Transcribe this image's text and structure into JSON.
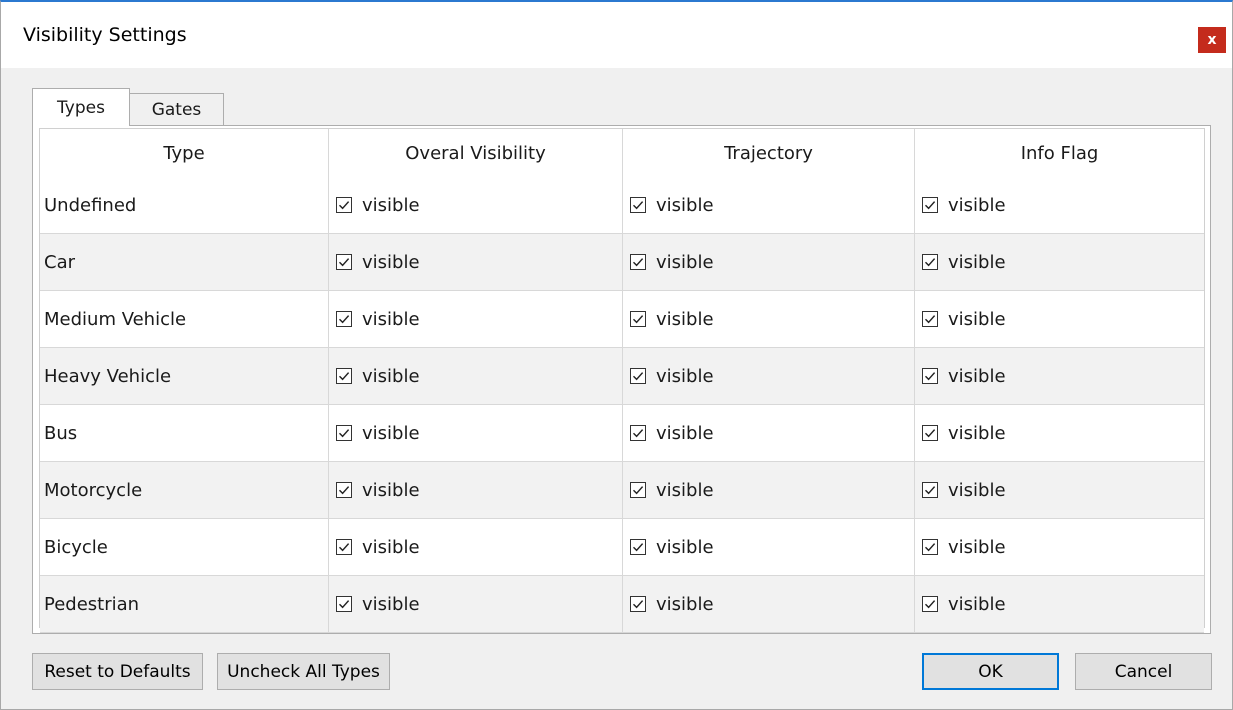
{
  "window": {
    "title": "Visibility Settings",
    "close_label": "x"
  },
  "tabs": [
    {
      "label": "Types",
      "active": true
    },
    {
      "label": "Gates",
      "active": false
    }
  ],
  "table": {
    "headers": [
      "Type",
      "Overal Visibility",
      "Trajectory",
      "Info Flag"
    ],
    "checkbox_label": "visible",
    "rows": [
      {
        "type": "Undefined",
        "overall": true,
        "trajectory": true,
        "info_flag": true
      },
      {
        "type": "Car",
        "overall": true,
        "trajectory": true,
        "info_flag": true
      },
      {
        "type": "Medium Vehicle",
        "overall": true,
        "trajectory": true,
        "info_flag": true
      },
      {
        "type": "Heavy Vehicle",
        "overall": true,
        "trajectory": true,
        "info_flag": true
      },
      {
        "type": "Bus",
        "overall": true,
        "trajectory": true,
        "info_flag": true
      },
      {
        "type": "Motorcycle",
        "overall": true,
        "trajectory": true,
        "info_flag": true
      },
      {
        "type": "Bicycle",
        "overall": true,
        "trajectory": true,
        "info_flag": true
      },
      {
        "type": "Pedestrian",
        "overall": true,
        "trajectory": true,
        "info_flag": true
      }
    ]
  },
  "buttons": {
    "reset_label": "Reset to Defaults",
    "uncheck_label": "Uncheck All Types",
    "ok_label": "OK",
    "cancel_label": "Cancel"
  },
  "colors": {
    "accent": "#0078d7",
    "close": "#c42b1c",
    "title_border": "#2b79d0"
  }
}
